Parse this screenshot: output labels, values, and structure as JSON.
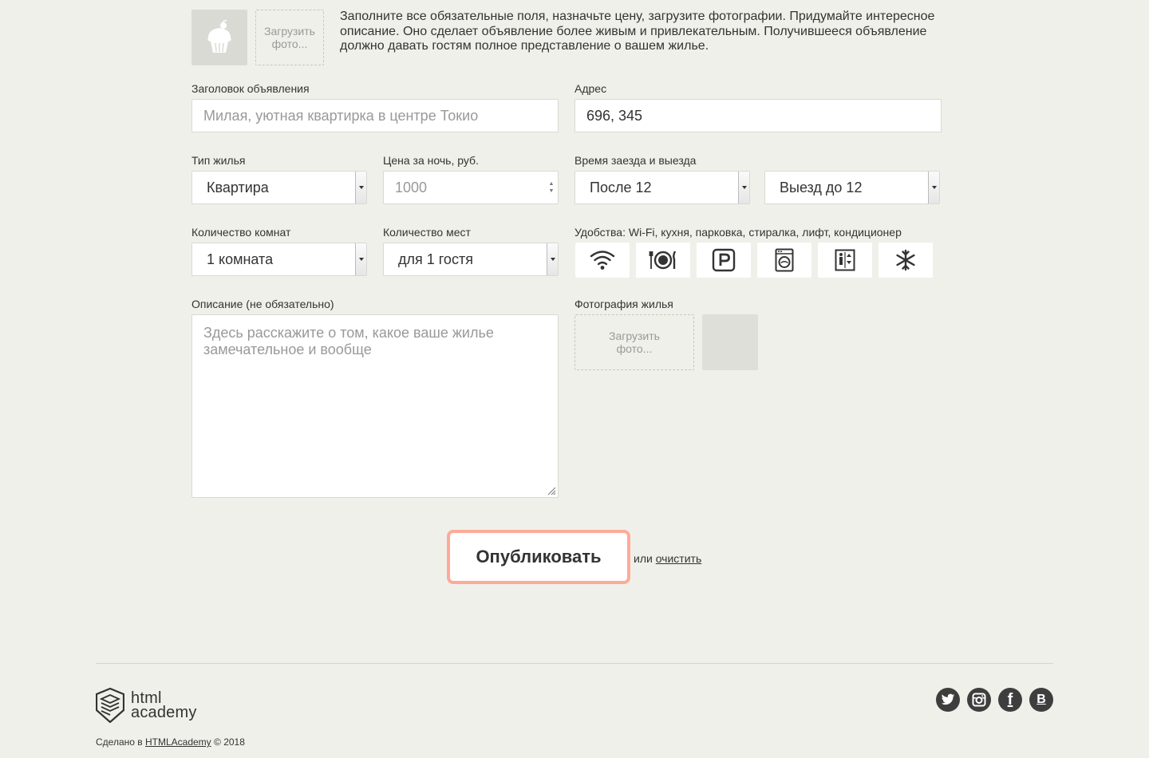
{
  "intro": {
    "avatar_upload_label": "Загрузить фото...",
    "text": "Заполните все обязательные поля, назначьте цену, загрузите фотографии. Придумайте интересное описание. Оно сделает объявление более живым и привлекательным. Получившееся объявление должно давать гостям полное представление о вашем жилье."
  },
  "form": {
    "title": {
      "label": "Заголовок объявления",
      "placeholder": "Милая, уютная квартирка в центре Токио",
      "value": ""
    },
    "address": {
      "label": "Адрес",
      "value": "696, 345"
    },
    "type": {
      "label": "Тип жилья",
      "selected": "Квартира"
    },
    "price": {
      "label": "Цена за ночь, руб.",
      "placeholder": "1000"
    },
    "time": {
      "label": "Время заезда и выезда",
      "checkin": "После 12",
      "checkout": "Выезд до 12"
    },
    "rooms": {
      "label": "Количество комнат",
      "selected": "1 комната"
    },
    "capacity": {
      "label": "Количество мест",
      "selected": "для 1 гостя"
    },
    "features": {
      "label": "Удобства: Wi-Fi, кухня, парковка, стиралка, лифт, кондиционер",
      "items": [
        {
          "name": "wifi",
          "icon": "wifi-icon"
        },
        {
          "name": "dishwasher",
          "icon": "plate-icon"
        },
        {
          "name": "parking",
          "icon": "parking-icon"
        },
        {
          "name": "washer",
          "icon": "washer-icon"
        },
        {
          "name": "elevator",
          "icon": "elevator-icon"
        },
        {
          "name": "conditioner",
          "icon": "snowflake-icon"
        }
      ]
    },
    "description": {
      "label": "Описание (не обязательно)",
      "placeholder": "Здесь расскажите о том, какое ваше жилье замечательное и вообще"
    },
    "photos": {
      "label": "Фотография жилья",
      "upload_label": "Загрузить фото..."
    },
    "submit_label": "Опубликовать",
    "or_text": "или",
    "reset_label": "очистить"
  },
  "footer": {
    "logo_line1": "html",
    "logo_line2": "academy",
    "copyright_prefix": "Сделано в",
    "copyright_link": "HTMLAcademy",
    "copyright_suffix": "© 2018",
    "social": [
      {
        "name": "twitter",
        "glyph": ""
      },
      {
        "name": "instagram",
        "glyph": ""
      },
      {
        "name": "facebook",
        "glyph": "f"
      },
      {
        "name": "vk",
        "glyph": "B"
      }
    ]
  },
  "colors": {
    "background": "#f0f0ea",
    "submit_border": "#ffaa99",
    "text": "#333333",
    "placeholder": "#999999"
  }
}
